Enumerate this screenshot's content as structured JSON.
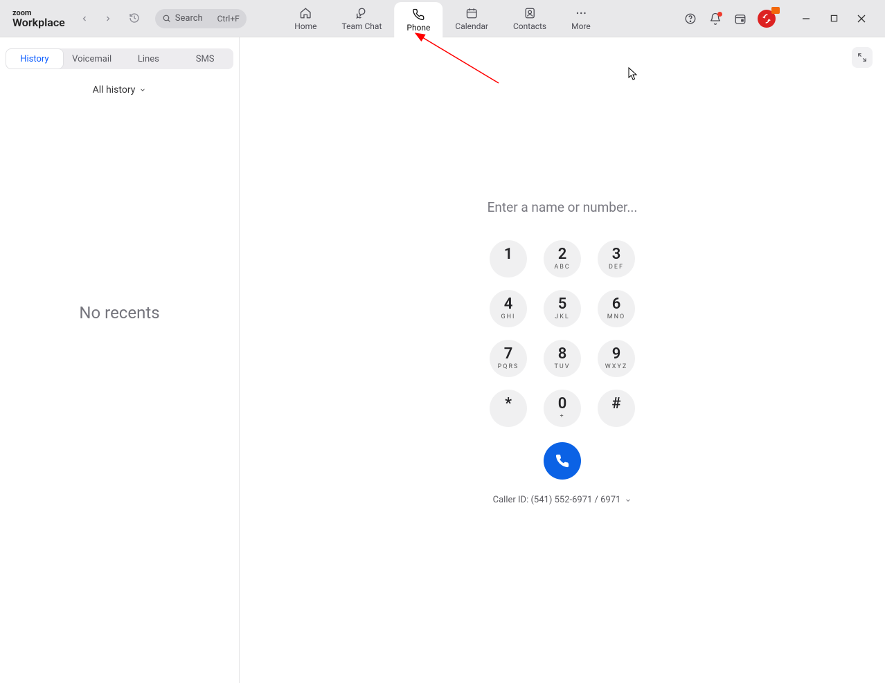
{
  "brand": {
    "line1": "zoom",
    "line2": "Workplace"
  },
  "search": {
    "placeholder": "Search",
    "shortcut": "Ctrl+F"
  },
  "main_tabs": [
    {
      "label": "Home"
    },
    {
      "label": "Team Chat"
    },
    {
      "label": "Phone"
    },
    {
      "label": "Calendar"
    },
    {
      "label": "Contacts"
    },
    {
      "label": "More"
    }
  ],
  "sub_tabs": [
    {
      "label": "History"
    },
    {
      "label": "Voicemail"
    },
    {
      "label": "Lines"
    },
    {
      "label": "SMS"
    }
  ],
  "history_filter": "All history",
  "empty_state": "No recents",
  "dialer": {
    "placeholder": "Enter a name or number...",
    "keys": [
      {
        "d": "1",
        "l": ""
      },
      {
        "d": "2",
        "l": "ABC"
      },
      {
        "d": "3",
        "l": "DEF"
      },
      {
        "d": "4",
        "l": "GHI"
      },
      {
        "d": "5",
        "l": "JKL"
      },
      {
        "d": "6",
        "l": "MNO"
      },
      {
        "d": "7",
        "l": "PQRS"
      },
      {
        "d": "8",
        "l": "TUV"
      },
      {
        "d": "9",
        "l": "WXYZ"
      },
      {
        "d": "*",
        "l": ""
      },
      {
        "d": "0",
        "l": "+"
      },
      {
        "d": "#",
        "l": ""
      }
    ],
    "caller_id": "Caller ID: (541) 552-6971 / 6971"
  }
}
